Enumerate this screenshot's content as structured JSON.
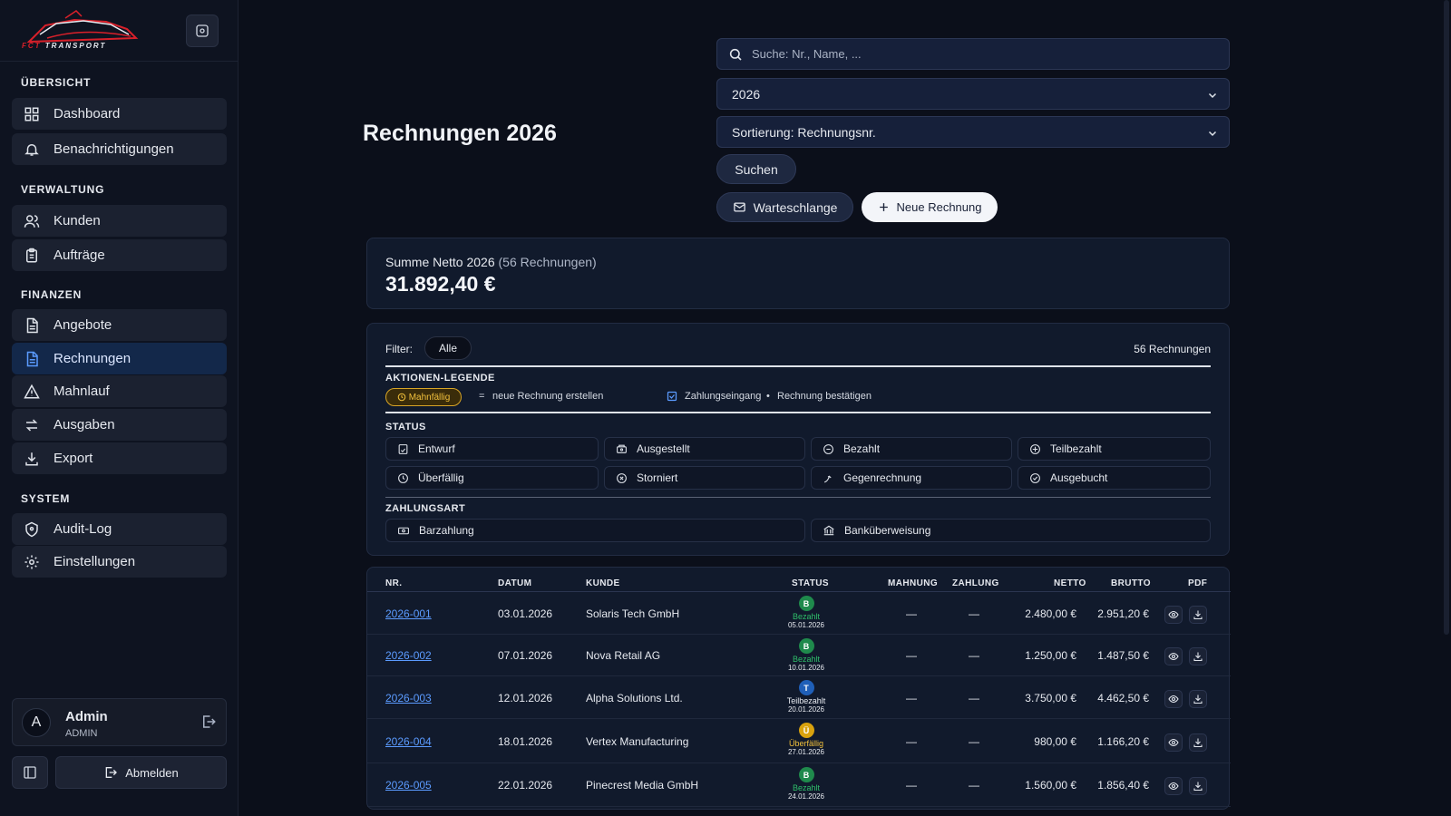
{
  "brand": {
    "logo_text_a": "FCT",
    "logo_text_b": "TRANSPORT"
  },
  "sidebar": {
    "sections": {
      "overview": "ÜBERSICHT",
      "admin": "VERWALTUNG",
      "finance": "FINANZEN",
      "system": "SYSTEM"
    },
    "items": {
      "dashboard": "Dashboard",
      "notifications": "Benachrichtigungen",
      "customers": "Kunden",
      "orders": "Aufträge",
      "offers": "Angebote",
      "invoices": "Rechnungen",
      "dunning": "Mahnlauf",
      "expenses": "Ausgaben",
      "export": "Export",
      "audit": "Audit-Log",
      "settings": "Einstellungen"
    },
    "active": "invoices",
    "user": {
      "initial": "A",
      "name": "Admin",
      "role": "ADMIN"
    },
    "logout_label": "Abmelden"
  },
  "header": {
    "title": "Rechnungen 2026",
    "search_placeholder": "Suche: Nr., Name, ...",
    "year_select": "2026",
    "sort_select": "Sortierung: Rechnungsnr.",
    "search_button": "Suchen",
    "queue_button": "Warteschlange",
    "new_button": "Neue Rechnung"
  },
  "summary": {
    "label": "Summe Netto 2026",
    "count_note": "(56 Rechnungen)",
    "value": "31.892,40 €"
  },
  "filter": {
    "label": "Filter:",
    "pill": "Alle",
    "count": "56 Rechnungen",
    "legend_title": "AKTIONEN-LEGENDE",
    "legend_badge": "Mahnfällig",
    "legend_eq": "=",
    "legend_text1": "neue Rechnung erstellen",
    "legend_text2": "Zahlungseingang",
    "legend_dot": "•",
    "legend_text3": "Rechnung bestätigen",
    "status_title": "STATUS",
    "statuses": [
      "Entwurf",
      "Ausgestellt",
      "Bezahlt",
      "Teilbezahlt",
      "Überfällig",
      "Storniert",
      "Gegenrechnung",
      "Ausgebucht"
    ],
    "payment_title": "ZAHLUNGSART",
    "payments": [
      "Barzahlung",
      "Banküberweisung"
    ]
  },
  "table": {
    "headers": {
      "nr": "NR.",
      "date": "DATUM",
      "customer": "KUNDE",
      "status": "STATUS",
      "dunning": "MAHNUNG",
      "payment": "ZAHLUNG",
      "net": "NETTO",
      "gross": "BRUTTO",
      "pdf": "PDF"
    },
    "rows": [
      {
        "nr": "2026-001",
        "date": "03.01.2026",
        "customer": "Solaris Tech GmbH",
        "status_letter": "B",
        "status": "Bezahlt",
        "status_date": "05.01.2026",
        "status_color": "#1f8a4c",
        "label_color": "#2fbf6a",
        "dunning": "—",
        "payment": "—",
        "net": "2.480,00 €",
        "gross": "2.951,20 €"
      },
      {
        "nr": "2026-002",
        "date": "07.01.2026",
        "customer": "Nova Retail AG",
        "status_letter": "B",
        "status": "Bezahlt",
        "status_date": "10.01.2026",
        "status_color": "#1f8a4c",
        "label_color": "#2fbf6a",
        "dunning": "—",
        "payment": "—",
        "net": "1.250,00 €",
        "gross": "1.487,50 €"
      },
      {
        "nr": "2026-003",
        "date": "12.01.2026",
        "customer": "Alpha Solutions Ltd.",
        "status_letter": "T",
        "status": "Teilbezahlt",
        "status_date": "20.01.2026",
        "status_color": "#1f5fb8",
        "label_color": "#e6e9ef",
        "dunning": "—",
        "payment": "—",
        "net": "3.750,00 €",
        "gross": "4.462,50 €"
      },
      {
        "nr": "2026-004",
        "date": "18.01.2026",
        "customer": "Vertex Manufacturing",
        "status_letter": "Ü",
        "status": "Überfällig",
        "status_date": "27.01.2026",
        "status_color": "#d9a20e",
        "label_color": "#f2c13c",
        "dunning": "—",
        "payment": "—",
        "net": "980,00 €",
        "gross": "1.166,20 €"
      },
      {
        "nr": "2026-005",
        "date": "22.01.2026",
        "customer": "Pinecrest Media GmbH",
        "status_letter": "B",
        "status": "Bezahlt",
        "status_date": "24.01.2026",
        "status_color": "#1f8a4c",
        "label_color": "#2fbf6a",
        "dunning": "—",
        "payment": "—",
        "net": "1.560,00 €",
        "gross": "1.856,40 €"
      }
    ]
  },
  "colors": {
    "accent": "#5b9bff",
    "active_nav": "#13284a",
    "warning": "#f2c13c",
    "paid": "#1f8a4c"
  }
}
